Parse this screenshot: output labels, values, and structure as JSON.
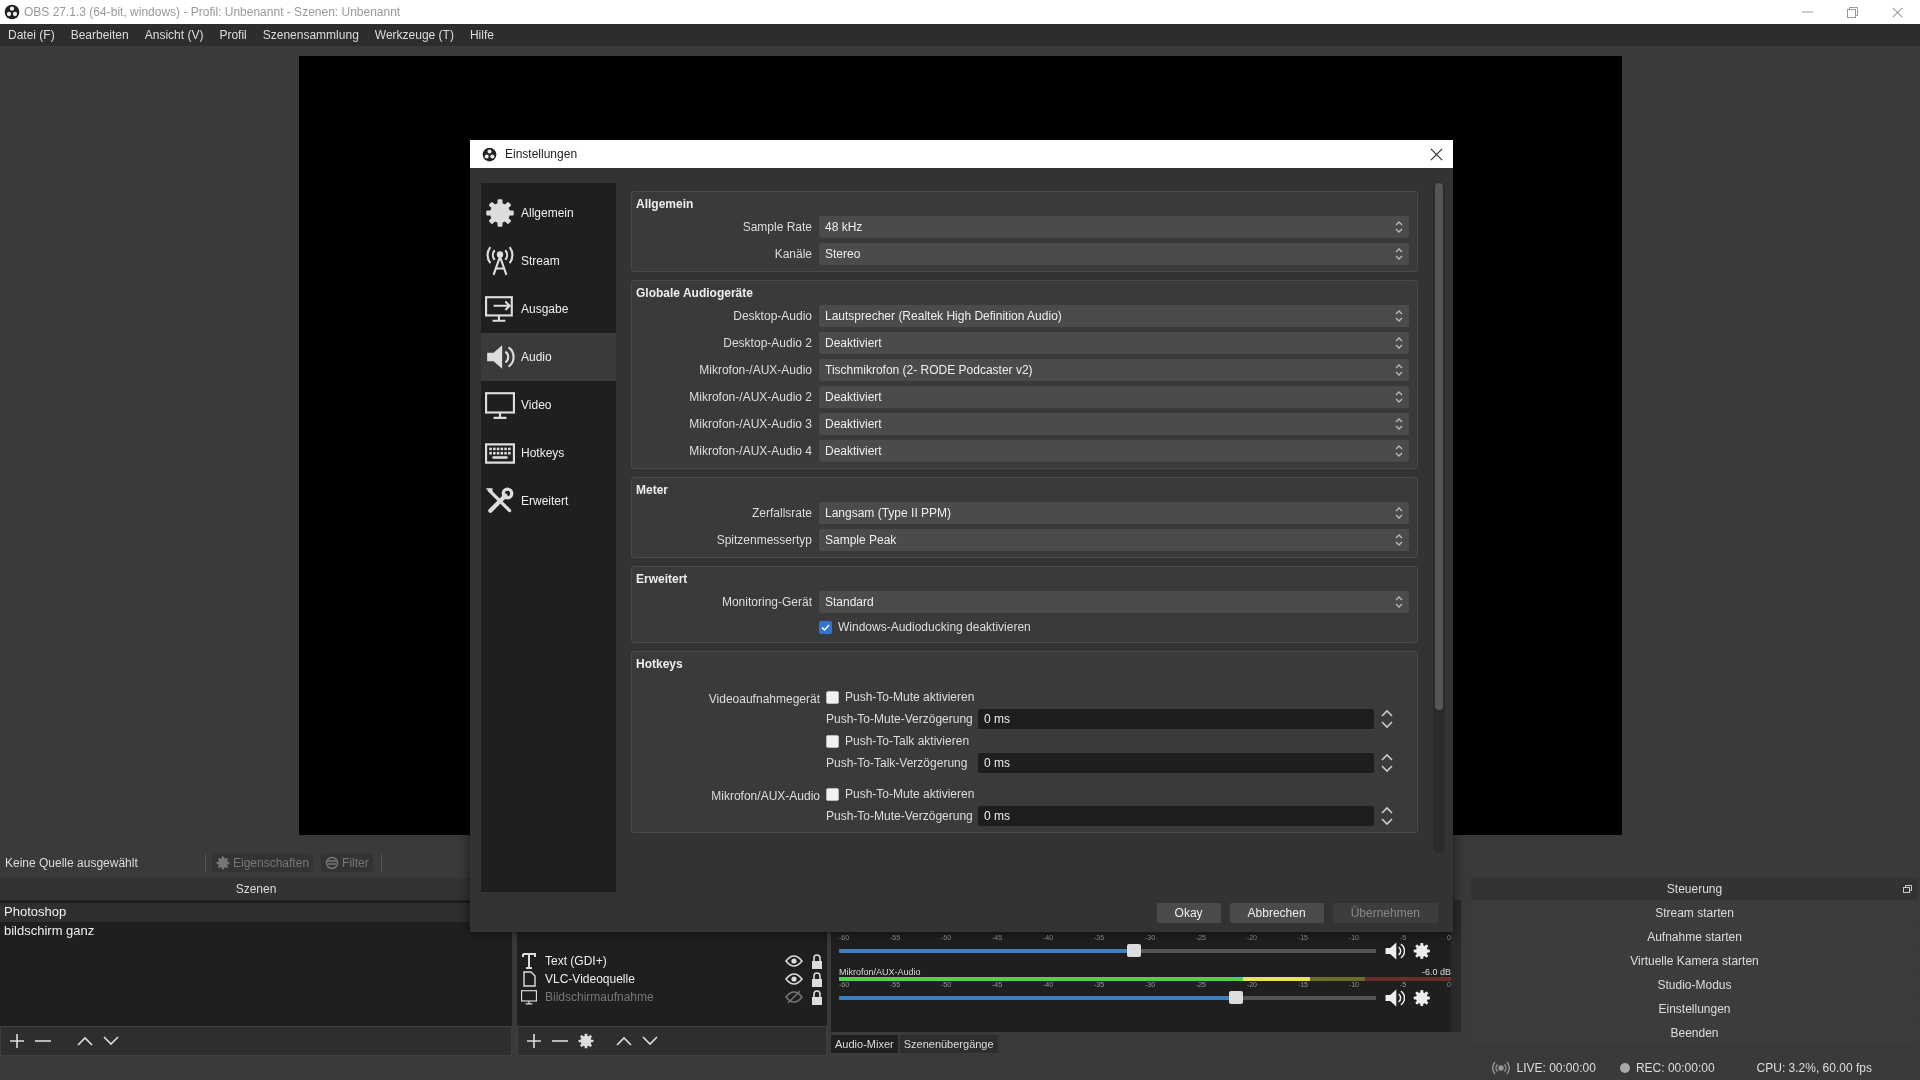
{
  "app_window": {
    "title": "OBS 27.1.3 (64-bit, windows) - Profil: Unbenannt - Szenen: Unbenannt"
  },
  "menu": [
    "Datei (F)",
    "Bearbeiten",
    "Ansicht (V)",
    "Profil",
    "Szenensammlung",
    "Werkzeuge (T)",
    "Hilfe"
  ],
  "source_toolbar": {
    "status": "Keine Quelle ausgewählt",
    "buttons": [
      {
        "label": "Eigenschaften",
        "kind": "properties",
        "disabled": true
      },
      {
        "label": "Filter",
        "kind": "filter",
        "disabled": true
      }
    ]
  },
  "scenes": {
    "title": "Szenen",
    "items": [
      {
        "name": "Photoshop",
        "selected": true
      },
      {
        "name": "bildschirm ganz",
        "selected": false
      }
    ]
  },
  "sources": {
    "items": [
      {
        "name": "Text (GDI+)",
        "kind": "text",
        "visible": true,
        "locked": true
      },
      {
        "name": "VLC-Videoquelle",
        "kind": "file",
        "visible": true,
        "locked": true
      },
      {
        "name": "Bildschirmaufnahme",
        "kind": "display",
        "visible": false,
        "locked": true
      }
    ]
  },
  "mixer": {
    "tracks": [
      {
        "ticks": [
          "-60",
          "-55",
          "-50",
          "-45",
          "-40",
          "-35",
          "-30",
          "-25",
          "-20",
          "-15",
          "-10",
          "-5",
          "0"
        ],
        "volume": {
          "level": 0.55
        }
      },
      {
        "name": "Mikrofon/AUX-Audio",
        "reading": "-6.0 dB",
        "meter": {
          "level": 0.77
        },
        "ticks": [
          "-60",
          "-55",
          "-50",
          "-45",
          "-40",
          "-35",
          "-30",
          "-25",
          "-20",
          "-15",
          "-10",
          "-5",
          "0"
        ],
        "volume": {
          "level": 0.74
        }
      }
    ],
    "tabs": [
      {
        "label": "Audio-Mixer",
        "selected": true
      },
      {
        "label": "Szenenübergänge",
        "selected": false
      }
    ]
  },
  "controls": {
    "title": "Steuerung",
    "buttons": [
      "Stream starten",
      "Aufnahme starten",
      "Virtuelle Kamera starten",
      "Studio-Modus",
      "Einstellungen",
      "Beenden"
    ]
  },
  "status_bar": {
    "live": "LIVE: 00:00:00",
    "rec": "REC: 00:00:00",
    "cpu": "CPU: 3.2%, 60.00 fps"
  },
  "settings_dialog": {
    "title": "Einstellungen",
    "sidebar": [
      {
        "label": "Allgemein",
        "kind": "gear",
        "selected": false
      },
      {
        "label": "Stream",
        "kind": "antenna",
        "selected": false
      },
      {
        "label": "Ausgabe",
        "kind": "output",
        "selected": false
      },
      {
        "label": "Audio",
        "kind": "speaker",
        "selected": true
      },
      {
        "label": "Video",
        "kind": "monitor",
        "selected": false
      },
      {
        "label": "Hotkeys",
        "kind": "keyboard",
        "selected": false
      },
      {
        "label": "Erweitert",
        "kind": "tools",
        "selected": false
      }
    ],
    "groups": [
      {
        "title": "Allgemein",
        "rows": [
          {
            "kind": "select",
            "label": "Sample Rate",
            "value": "48 kHz"
          },
          {
            "kind": "select",
            "label": "Kanäle",
            "value": "Stereo"
          }
        ]
      },
      {
        "title": "Globale Audiogeräte",
        "rows": [
          {
            "kind": "select",
            "label": "Desktop-Audio",
            "value": "Lautsprecher (Realtek High Definition Audio)"
          },
          {
            "kind": "select",
            "label": "Desktop-Audio 2",
            "value": "Deaktiviert"
          },
          {
            "kind": "select",
            "label": "Mikrofon-/AUX-Audio",
            "value": "Tischmikrofon (2- RODE Podcaster v2)"
          },
          {
            "kind": "select",
            "label": "Mikrofon-/AUX-Audio 2",
            "value": "Deaktiviert"
          },
          {
            "kind": "select",
            "label": "Mikrofon-/AUX-Audio 3",
            "value": "Deaktiviert"
          },
          {
            "kind": "select",
            "label": "Mikrofon-/AUX-Audio 4",
            "value": "Deaktiviert"
          }
        ]
      },
      {
        "title": "Meter",
        "rows": [
          {
            "kind": "select",
            "label": "Zerfallsrate",
            "value": "Langsam (Type II PPM)"
          },
          {
            "kind": "select",
            "label": "Spitzenmessertyp",
            "value": "Sample Peak"
          }
        ]
      },
      {
        "title": "Erweitert",
        "rows": [
          {
            "kind": "select",
            "label": "Monitoring-Gerät",
            "value": "Standard"
          },
          {
            "kind": "checkbox",
            "label": "Windows-Audioducking deaktivieren",
            "checked": true
          }
        ]
      },
      {
        "title": "Hotkeys",
        "devices": [
          {
            "name": "Videoaufnahmegerät",
            "rows": [
              {
                "kind": "checkbox",
                "label": "Push-To-Mute aktivieren",
                "checked": false
              },
              {
                "kind": "spin",
                "label": "Push-To-Mute-Verzögerung",
                "value": "0 ms"
              },
              {
                "kind": "checkbox",
                "label": "Push-To-Talk aktivieren",
                "checked": false
              },
              {
                "kind": "spin",
                "label": "Push-To-Talk-Verzögerung",
                "value": "0 ms"
              }
            ]
          },
          {
            "name": "Mikrofon/AUX-Audio",
            "rows": [
              {
                "kind": "checkbox",
                "label": "Push-To-Mute aktivieren",
                "checked": false
              },
              {
                "kind": "spin",
                "label": "Push-To-Mute-Verzögerung",
                "value": "0 ms"
              }
            ]
          }
        ]
      }
    ],
    "buttons": [
      {
        "label": "Okay",
        "disabled": false
      },
      {
        "label": "Abbrechen",
        "disabled": false
      },
      {
        "label": "Übernehmen",
        "disabled": true
      }
    ]
  }
}
